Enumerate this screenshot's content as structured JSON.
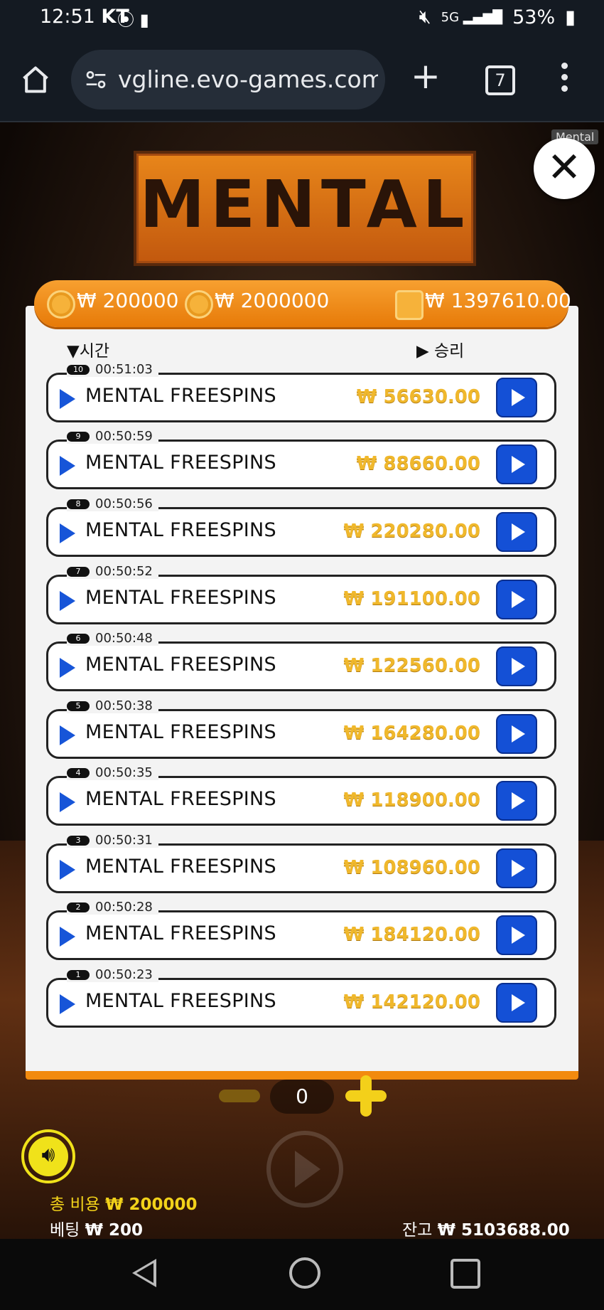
{
  "status": {
    "time": "12:51",
    "carrier": "KT",
    "signal_label": "5G",
    "battery": "53%"
  },
  "browser": {
    "url": "vgline.evo-games.com/",
    "tab_count": "7"
  },
  "game": {
    "logo_text": "MENTAL",
    "close_tooltip": "Mental",
    "header": {
      "cost_1": "₩ 200000",
      "cost_2": "₩ 2000000",
      "wallet": "₩ 1397610.00"
    },
    "sort_time_label": "▼시간",
    "sort_win_label": "▶ 승리",
    "history": [
      {
        "index": "10",
        "time": "00:51:03",
        "name": "MENTAL FREESPINS",
        "amount": "₩ 56630.00"
      },
      {
        "index": "9",
        "time": "00:50:59",
        "name": "MENTAL FREESPINS",
        "amount": "₩ 88660.00"
      },
      {
        "index": "8",
        "time": "00:50:56",
        "name": "MENTAL FREESPINS",
        "amount": "₩ 220280.00"
      },
      {
        "index": "7",
        "time": "00:50:52",
        "name": "MENTAL FREESPINS",
        "amount": "₩ 191100.00"
      },
      {
        "index": "6",
        "time": "00:50:48",
        "name": "MENTAL FREESPINS",
        "amount": "₩ 122560.00"
      },
      {
        "index": "5",
        "time": "00:50:38",
        "name": "MENTAL FREESPINS",
        "amount": "₩ 164280.00"
      },
      {
        "index": "4",
        "time": "00:50:35",
        "name": "MENTAL FREESPINS",
        "amount": "₩ 118900.00"
      },
      {
        "index": "3",
        "time": "00:50:31",
        "name": "MENTAL FREESPINS",
        "amount": "₩ 108960.00"
      },
      {
        "index": "2",
        "time": "00:50:28",
        "name": "MENTAL FREESPINS",
        "amount": "₩ 184120.00"
      },
      {
        "index": "1",
        "time": "00:50:23",
        "name": "MENTAL FREESPINS",
        "amount": "₩ 142120.00"
      }
    ],
    "counter": "0",
    "total_cost_label": "총 비용",
    "total_cost_value": "₩ 200000",
    "bet_label": "베팅",
    "bet_value": "₩ 200",
    "balance_label": "잔고",
    "balance_value": "₩ 5103688.00"
  },
  "colors": {
    "accent_orange": "#f28a0e",
    "play_blue": "#1450d6",
    "amount_gold": "#f0b82c"
  }
}
